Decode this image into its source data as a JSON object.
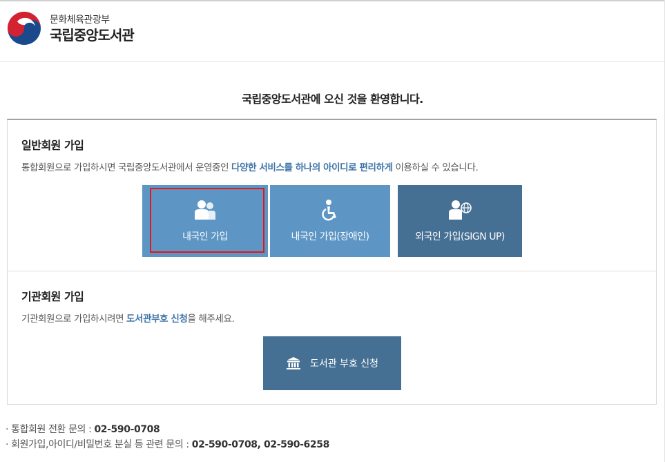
{
  "header": {
    "ministry": "문화체육관광부",
    "library": "국립중앙도서관"
  },
  "welcome": "국립중앙도서관에 오신 것을 환영합니다.",
  "general": {
    "title": "일반회원 가입",
    "desc_prefix": "통합회원으로 가입하시면 국립중앙도서관에서 운영중인 ",
    "desc_highlight": "다양한 서비스를 하나의 아이디로 편리하게",
    "desc_suffix": " 이용하실 수 있습니다.",
    "buttons": {
      "domestic": "내국인 가입",
      "disabled": "내국인 가입(장애인)",
      "foreign": "외국인 가입(SIGN UP)"
    }
  },
  "institution": {
    "title": "기관회원 가입",
    "desc_prefix": "기관회원으로 가입하시려면 ",
    "desc_highlight": "도서관부호 신청",
    "desc_suffix": "을 해주세요.",
    "button": "도서관 부호 신청"
  },
  "contacts": [
    {
      "label": "· 통합회원 전환 문의 : ",
      "number": "02-590-0708"
    },
    {
      "label": "· 회원가입,아이디/비밀번호 분실 등 관련 문의 : ",
      "number": "02-590-0708, 02-590-6258"
    }
  ],
  "colors": {
    "primary_button": "#5d95c4",
    "dark_button": "#456f93",
    "highlight_text": "#3f74a8",
    "selection_box": "#e8141b"
  },
  "icons": {
    "emblem": "taegeuk-emblem-icon",
    "domestic": "users-icon",
    "disabled": "wheelchair-icon",
    "foreign": "user-globe-icon",
    "institution": "bank-building-icon"
  }
}
